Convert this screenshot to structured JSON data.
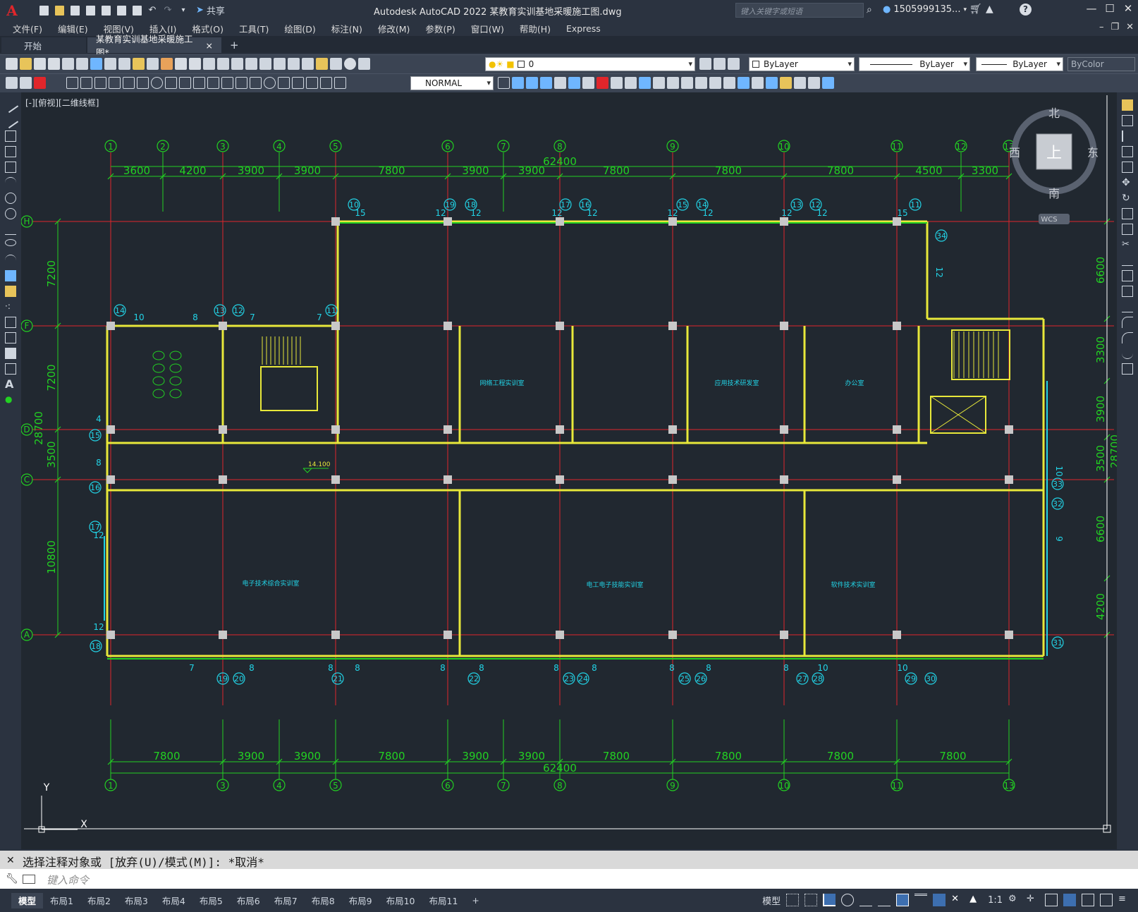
{
  "app": {
    "title": "Autodesk AutoCAD 2022    某教育实训基地采暖施工图.dwg",
    "logo": "A",
    "share_label": "共享",
    "search_placeholder": "键入关键字或短语",
    "user": "1505999135...",
    "help": "?"
  },
  "menu": [
    "文件(F)",
    "编辑(E)",
    "视图(V)",
    "插入(I)",
    "格式(O)",
    "工具(T)",
    "绘图(D)",
    "标注(N)",
    "修改(M)",
    "参数(P)",
    "窗口(W)",
    "帮助(H)",
    "Express"
  ],
  "tabs": {
    "start": "开始",
    "active": "某教育实训基地采暖施工图*",
    "close": "×",
    "add": "+"
  },
  "toolbar": {
    "layer_value": "0",
    "color": "ByLayer",
    "linetype": "ByLayer",
    "lineweight": "ByLayer",
    "plotstyle": "ByColor",
    "textstyle": "NORMAL"
  },
  "viewport": {
    "label": "[-][俯视][二维线框]",
    "compass": {
      "north": "北",
      "south": "南",
      "east": "东",
      "west": "西",
      "top": "上",
      "wcs": "WCS"
    },
    "ucs": {
      "x": "X",
      "y": "Y"
    }
  },
  "drawing": {
    "top_axes": [
      "1",
      "2",
      "3",
      "4",
      "5",
      "6",
      "7",
      "8",
      "9",
      "10",
      "11",
      "12",
      "13"
    ],
    "bottom_axes": [
      "1",
      "3",
      "4",
      "5",
      "6",
      "7",
      "8",
      "9",
      "10",
      "11",
      "13"
    ],
    "row_axes": [
      "H",
      "F",
      "D",
      "C",
      "A"
    ],
    "top_total": "62400",
    "top_dims": [
      "3600",
      "4200",
      "3900",
      "3900",
      "7800",
      "3900",
      "3900",
      "7800",
      "7800",
      "7800",
      "4500",
      "3300"
    ],
    "bottom_total": "62400",
    "bottom_dims": [
      "7800",
      "3900",
      "3900",
      "7800",
      "3900",
      "3900",
      "7800",
      "7800",
      "7800",
      "7800"
    ],
    "left_total": "28700",
    "left_dims": [
      "7200",
      "7200",
      "3500",
      "10800"
    ],
    "right_dims": [
      "6600",
      "3300",
      "3900",
      "3500",
      "6600",
      "4200"
    ],
    "right_total": "28700",
    "rooms": [
      "网络工程实训室",
      "应用技术研发室",
      "办公室",
      "电子技术综合实训室",
      "电工电子技能实训室",
      "软件技术实训室"
    ],
    "level_mark": "14.100",
    "top_radiators": [
      "10",
      "19",
      "18",
      "17",
      "16",
      "15",
      "14",
      "13",
      "12",
      "11"
    ],
    "top_rad_sizes": [
      "15",
      "12",
      "12",
      "12",
      "12",
      "12",
      "12",
      "12",
      "12",
      "15"
    ],
    "bottom_radiators": [
      "19",
      "20",
      "21",
      "22",
      "23",
      "24",
      "25",
      "26",
      "27",
      "28",
      "29",
      "30"
    ],
    "bottom_rad_sizes": [
      "7",
      "8",
      "8",
      "8",
      "8",
      "8",
      "8",
      "8",
      "8",
      "8",
      "8",
      "10",
      "10"
    ],
    "left_radiators": [
      "14",
      "13",
      "12",
      "11",
      "15",
      "16",
      "17",
      "18"
    ],
    "left_rad_sizes": [
      "10",
      "8",
      "7",
      "7",
      "4",
      "8",
      "12",
      "12"
    ],
    "right_radiators": [
      "34",
      "33",
      "32",
      "31"
    ],
    "right_rad_sizes": [
      "12",
      "10",
      "9"
    ]
  },
  "command": {
    "history": "选择注释对象或 [放弃(U)/模式(M)]: *取消*",
    "placeholder": "键入命令"
  },
  "status": {
    "layouts": [
      "模型",
      "布局1",
      "布局2",
      "布局3",
      "布局4",
      "布局5",
      "布局6",
      "布局7",
      "布局8",
      "布局9",
      "布局10",
      "布局11"
    ],
    "add": "+",
    "model": "模型",
    "scale": "1:1"
  },
  "colors": {
    "background": "#212830",
    "axis_red": "#e0262b",
    "dim_green": "#22d122",
    "wall_yellow": "#e8e83a",
    "cyan": "#22d3e6",
    "column_grey": "#c8c8c8"
  }
}
